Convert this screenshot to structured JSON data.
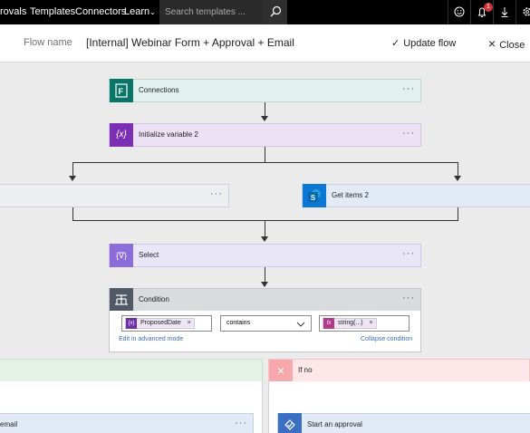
{
  "topnav": {
    "items": [
      "rovals",
      "Templates",
      "Connectors",
      "Learn"
    ],
    "search_placeholder": "Search templates ...",
    "notification_count": "1"
  },
  "cmdbar": {
    "flow_name_label": "Flow name",
    "flow_name_value": "[Internal] Webinar Form + Approval + Email",
    "update_label": "Update flow",
    "close_label": "Close"
  },
  "steps": {
    "connections": "Connections",
    "init_var": "Initialize variable 2",
    "get_items": "Get items 2",
    "select": "Select",
    "condition": "Condition",
    "email": "email",
    "start_approval": "Start an approval"
  },
  "condition": {
    "left_token": "ProposedDate",
    "operator": "contains",
    "right_token": "string(...)",
    "edit_advanced": "Edit in advanced mode",
    "collapse": "Collapse condition",
    "if_no": "If no"
  },
  "colors": {
    "forms": "#077568",
    "variable": "#7b2fb5",
    "sharepoint": "#0a78d4",
    "select": "#8c6cda",
    "condition": "#4f5a66"
  },
  "icons": {
    "more": "···",
    "remove": "×",
    "variable_glyph": "{x}",
    "fx": "fx"
  }
}
